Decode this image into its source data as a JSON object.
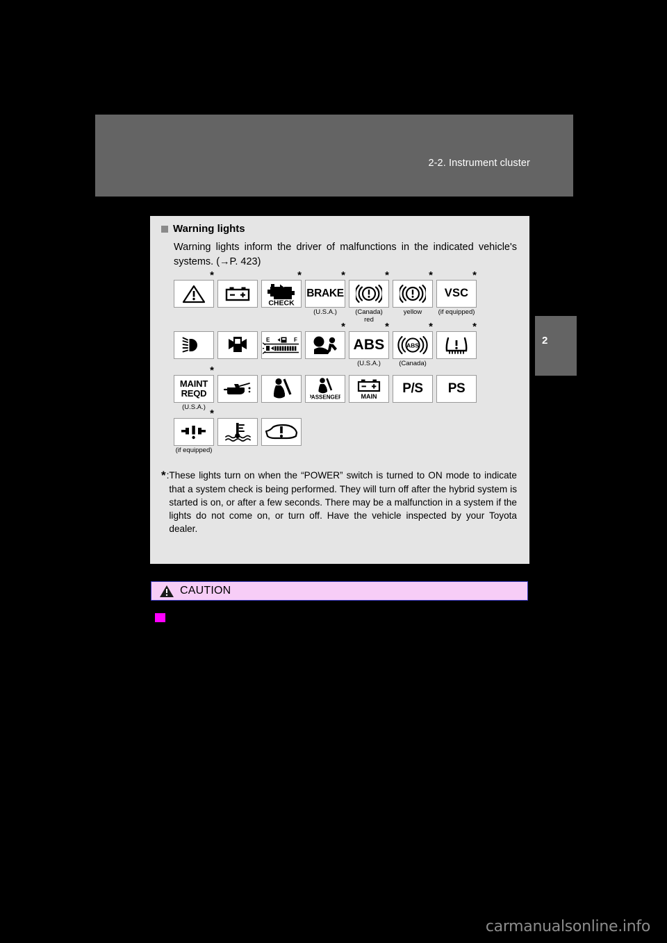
{
  "header": {
    "title": "2-2. Instrument cluster",
    "chapter_number": "2"
  },
  "panel": {
    "section_heading": "Warning lights",
    "intro_text": "Warning lights inform the driver of malfunctions in the indicated vehicle's systems. (→P. 423)",
    "footnote_marker": "*",
    "footnote_colon": ":",
    "footnote_text": "These lights turn on when the “POWER” switch is turned to ON mode to indicate that a system check is being performed. They will turn off after the hybrid system is started is on, or after a few seconds. There may be a malfunction in a system if the lights do not come on, or turn off. Have the vehicle inspected by your Toyota dealer."
  },
  "icon_rows": [
    {
      "row_name": "row-1",
      "icons": [
        {
          "name": "brake-system-warning-triangle-icon",
          "glyph": "warning-triangle",
          "star": true,
          "caption": ""
        },
        {
          "name": "charging-system-battery-icon",
          "glyph": "battery",
          "star": false,
          "caption": ""
        },
        {
          "name": "check-engine-icon",
          "glyph": "check-engine",
          "star": true,
          "caption": ""
        },
        {
          "name": "brake-warning-text-icon",
          "glyph": "text",
          "text": "BRAKE",
          "text_style": "brake",
          "star": true,
          "caption": "(U.S.A.)"
        },
        {
          "name": "brake-warning-canada-red-icon",
          "glyph": "brake-circle",
          "star": true,
          "caption": "(Canada)\nred"
        },
        {
          "name": "brake-warning-yellow-icon",
          "glyph": "brake-circle",
          "star": true,
          "caption": "yellow"
        },
        {
          "name": "vsc-warning-icon",
          "glyph": "text",
          "text": "VSC",
          "text_style": "vsc",
          "star": true,
          "caption": "(if equipped)"
        }
      ]
    },
    {
      "row_name": "row-2",
      "icons": [
        {
          "name": "headlight-high-beam-icon",
          "glyph": "headlight",
          "star": false,
          "caption": ""
        },
        {
          "name": "door-ajar-icon",
          "glyph": "door-open",
          "star": false,
          "caption": ""
        },
        {
          "name": "low-fuel-gauge-icon",
          "glyph": "fuel-gauge",
          "star": false,
          "caption": ""
        },
        {
          "name": "srs-airbag-icon",
          "glyph": "airbag",
          "star": true,
          "caption": ""
        },
        {
          "name": "abs-usa-icon",
          "glyph": "text",
          "text": "ABS",
          "text_style": "abs",
          "star": true,
          "caption": "(U.S.A.)"
        },
        {
          "name": "abs-canada-icon",
          "glyph": "abs-circle",
          "star": true,
          "caption": "(Canada)"
        },
        {
          "name": "tire-pressure-warning-icon",
          "glyph": "tpms",
          "star": true,
          "caption": ""
        }
      ]
    },
    {
      "row_name": "row-3",
      "icons": [
        {
          "name": "maintenance-required-icon",
          "glyph": "text",
          "text": "MAINT\nREQD",
          "text_style": "maint",
          "star": true,
          "caption": "(U.S.A.)"
        },
        {
          "name": "low-oil-pressure-icon",
          "glyph": "oil-can",
          "star": false,
          "caption": ""
        },
        {
          "name": "driver-seat-belt-icon",
          "glyph": "seatbelt",
          "star": false,
          "caption": ""
        },
        {
          "name": "passenger-seat-belt-icon",
          "glyph": "seatbelt-passenger",
          "star": false,
          "caption": ""
        },
        {
          "name": "main-battery-icon",
          "glyph": "battery-main",
          "star": false,
          "caption": ""
        },
        {
          "name": "power-steering-ps-slash-icon",
          "glyph": "text",
          "text": "P/S",
          "text_style": "ps",
          "star": false,
          "caption": ""
        },
        {
          "name": "power-steering-ps-icon",
          "glyph": "text",
          "text": "PS",
          "text_style": "ps",
          "star": false,
          "caption": ""
        }
      ]
    },
    {
      "row_name": "row-4",
      "icons": [
        {
          "name": "parking-brake-release-icon",
          "glyph": "parking-brake",
          "star": true,
          "caption": "(if equipped)"
        },
        {
          "name": "engine-coolant-temp-icon",
          "glyph": "coolant-temp",
          "star": false,
          "caption": ""
        },
        {
          "name": "hybrid-system-warning-icon",
          "glyph": "car-warning",
          "star": false,
          "caption": ""
        }
      ]
    }
  ],
  "caution": {
    "label": "CAUTION"
  },
  "watermark": {
    "text": "carmanualsonline.info"
  },
  "colors": {
    "page_background": "#000000",
    "header_band": "#646464",
    "panel_background": "#e5e5e5",
    "caution_background": "#f7cdf7",
    "caution_border": "#3b3bbf",
    "magenta_bullet": "#ff00ff",
    "watermark": "#8c8c8c"
  }
}
